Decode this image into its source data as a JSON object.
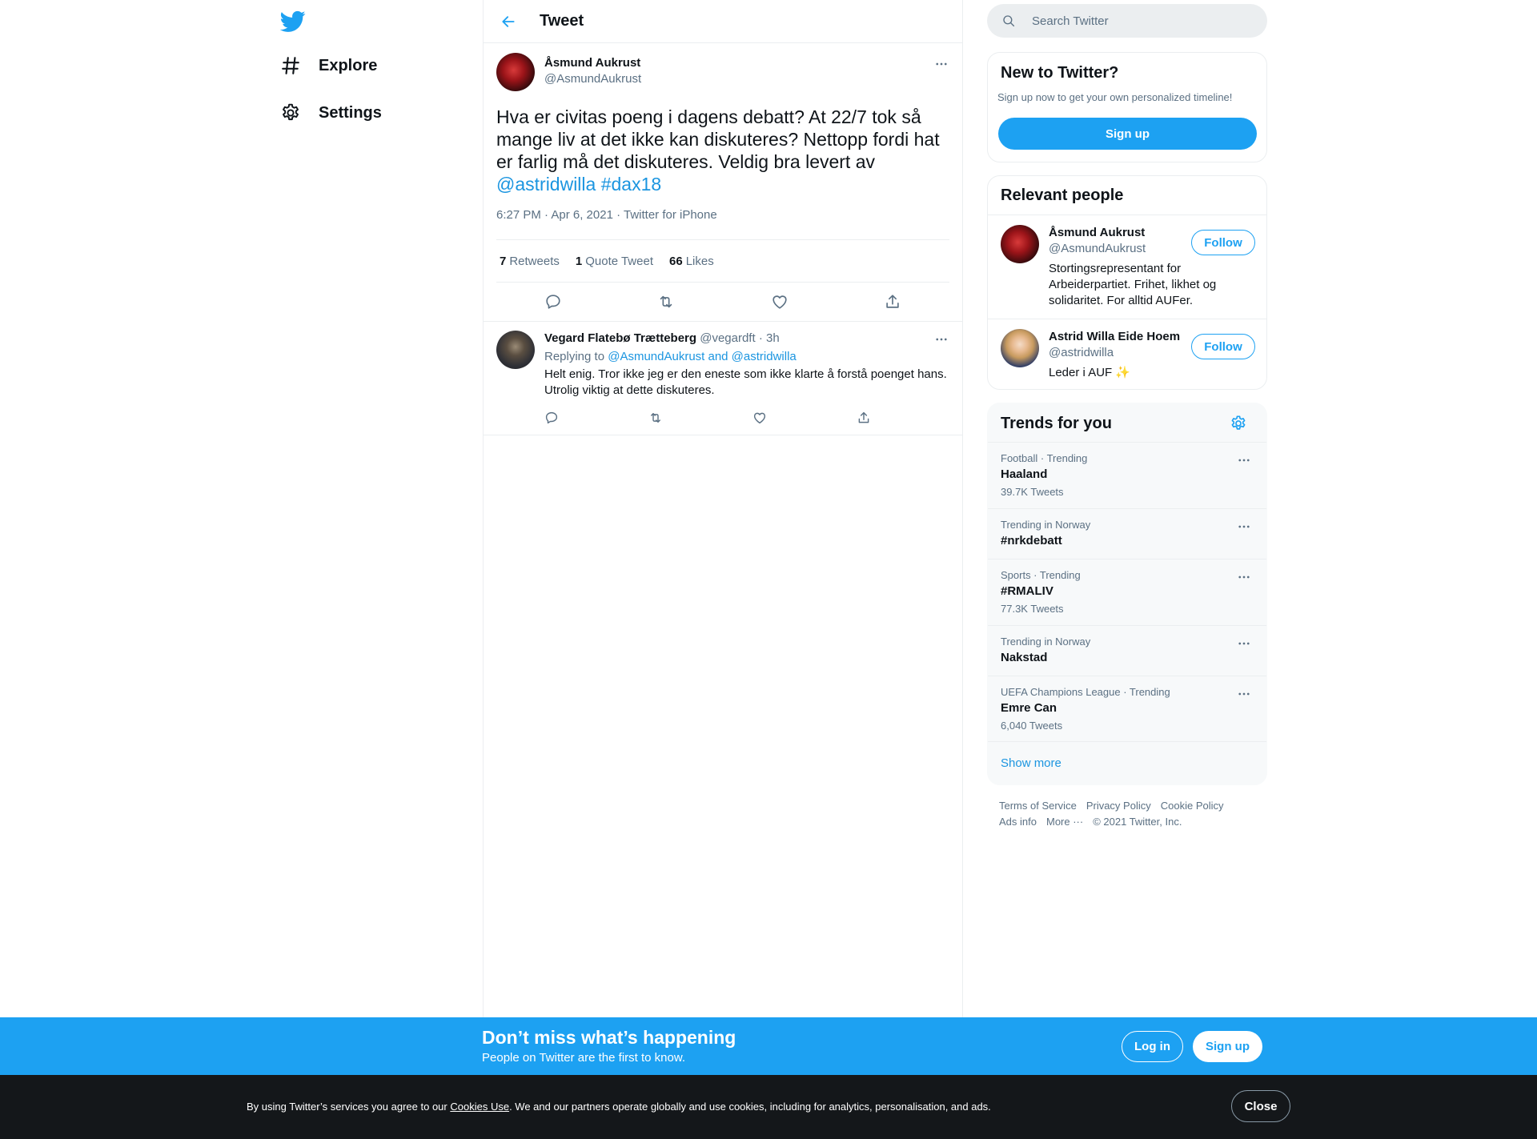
{
  "nav": {
    "logo_icon": "twitter-bird-icon",
    "items": [
      {
        "label": "Explore",
        "icon": "hashtag-icon"
      },
      {
        "label": "Settings",
        "icon": "gear-icon"
      }
    ]
  },
  "main": {
    "header_title": "Tweet",
    "tweet": {
      "author_name": "Åsmund Aukrust",
      "author_handle": "@AsmundAukrust",
      "text": "Hva er civitas poeng i dagens debatt? At 22/7 tok så mange liv at det ikke kan diskuteres? Nettopp fordi hat er farlig må det diskuteres. Veldig bra levert av ",
      "mention": "@astridwilla",
      "hashtag": "#dax18",
      "meta": "6:27 PM · Apr 6, 2021 · Twitter for iPhone",
      "retweets_count": "7",
      "retweets_label": "Retweets",
      "quotes_count": "1",
      "quotes_label": "Quote Tweet",
      "likes_count": "66",
      "likes_label": "Likes"
    },
    "reply": {
      "author_name": "Vegard Flatebø Trætteberg",
      "author_handle": "@vegardft",
      "time": "· 3h",
      "replying_prefix": "Replying to ",
      "replying_users": "@AsmundAukrust and @astridwilla",
      "text": "Helt enig. Tror ikke jeg er den eneste som ikke klarte å forstå poenget hans. Utrolig viktig at dette diskuteres."
    }
  },
  "sidebar": {
    "search_placeholder": "Search Twitter",
    "new_to_twitter": {
      "title": "New to Twitter?",
      "subtitle": "Sign up now to get your own personalized timeline!",
      "button": "Sign up"
    },
    "relevant_people": {
      "title": "Relevant people",
      "people": [
        {
          "name": "Åsmund Aukrust",
          "handle": "@AsmundAukrust",
          "bio": "Stortingsrepresentant for Arbeiderpartiet. Frihet, likhet og solidaritet. For alltid AUFer.",
          "button": "Follow"
        },
        {
          "name": "Astrid Willa Eide Hoem",
          "handle": "@astridwilla",
          "bio": "Leder i AUF ✨",
          "button": "Follow"
        }
      ]
    },
    "trends": {
      "title": "Trends for you",
      "items": [
        {
          "context": "Football · Trending",
          "name": "Haaland",
          "count": "39.7K Tweets"
        },
        {
          "context": "Trending in Norway",
          "name": "#nrkdebatt",
          "count": ""
        },
        {
          "context": "Sports · Trending",
          "name": "#RMALIV",
          "count": "77.3K Tweets"
        },
        {
          "context": "Trending in Norway",
          "name": "Nakstad",
          "count": ""
        },
        {
          "context": "UEFA Champions League · Trending",
          "name": "Emre Can",
          "count": "6,040 Tweets"
        }
      ],
      "show_more": "Show more"
    },
    "footer": {
      "links": [
        "Terms of Service",
        "Privacy Policy",
        "Cookie Policy",
        "Ads info",
        "More ···"
      ],
      "copyright": "© 2021 Twitter, Inc."
    }
  },
  "banner": {
    "title": "Don’t miss what’s happening",
    "subtitle": "People on Twitter are the first to know.",
    "login": "Log in",
    "signup": "Sign up"
  },
  "cookie": {
    "text_before": "By using Twitter’s services you agree to our ",
    "link": "Cookies Use",
    "text_after": ". We and our partners operate globally and use cookies, including for analytics, personalisation, and ads.",
    "close": "Close"
  },
  "colors": {
    "brand_blue": "#1da1f2",
    "link_blue": "#1b95e0",
    "text_primary": "#0f1419",
    "text_secondary": "#5b7083"
  }
}
